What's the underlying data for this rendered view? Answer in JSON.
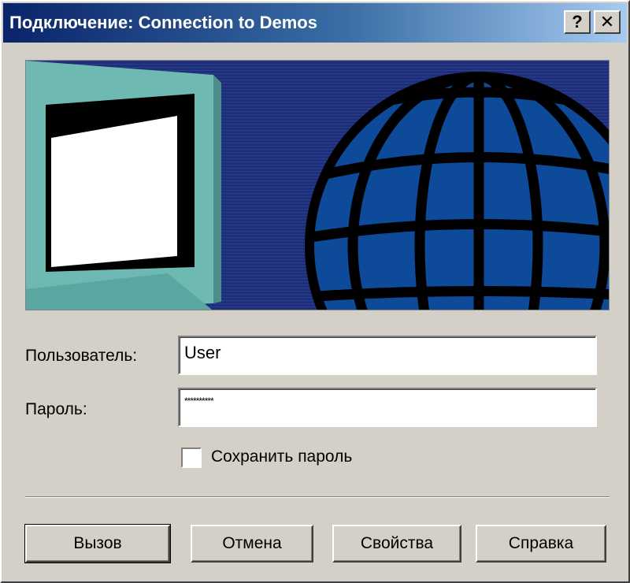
{
  "window": {
    "title": "Подключение: Connection to Demos",
    "help_glyph": "?",
    "close_glyph": "✕"
  },
  "form": {
    "user_label": "Пользователь:",
    "user_value": "User",
    "password_label": "Пароль:",
    "password_value": "**********",
    "save_password_label": "Сохранить пароль",
    "save_password_checked": false
  },
  "buttons": {
    "dial": "Вызов",
    "cancel": "Отмена",
    "properties": "Свойства",
    "help": "Справка"
  },
  "colors": {
    "titlebar_start": "#0a246a",
    "banner_background": "#1e2f7a",
    "globe": "#0e4a9a",
    "monitor": "#6fb9b3"
  }
}
